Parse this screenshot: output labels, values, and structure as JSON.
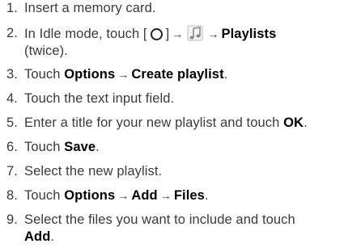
{
  "steps": [
    {
      "num": "1.",
      "text": "Insert a memory card."
    },
    {
      "num": "2.",
      "pre": "In Idle mode, touch [",
      "post": "]",
      "arrow1": "→",
      "arrow2": "→",
      "bold": "Playlists",
      "cont": "(twice).",
      "home_icon": "circle-home-icon",
      "music_icon": "music-note-icon"
    },
    {
      "num": "3.",
      "b1": "Options",
      "arrow": "→",
      "b2": "Create playlist",
      "pre": "Touch ",
      "post": "."
    },
    {
      "num": "4.",
      "text": "Touch the text input field."
    },
    {
      "num": "5.",
      "pre": "Enter a title for your new playlist and touch ",
      "bold": "OK",
      "post": "."
    },
    {
      "num": "6.",
      "pre": "Touch ",
      "bold": "Save",
      "post": "."
    },
    {
      "num": "7.",
      "text": "Select the new playlist."
    },
    {
      "num": "8.",
      "pre": "Touch ",
      "b1": "Options",
      "arrow1": "→",
      "b2": "Add",
      "arrow2": "→",
      "b3": "Files",
      "post": "."
    },
    {
      "num": "9.",
      "text": "Select the files you want to include and touch",
      "bold": "Add",
      "post": "."
    }
  ]
}
